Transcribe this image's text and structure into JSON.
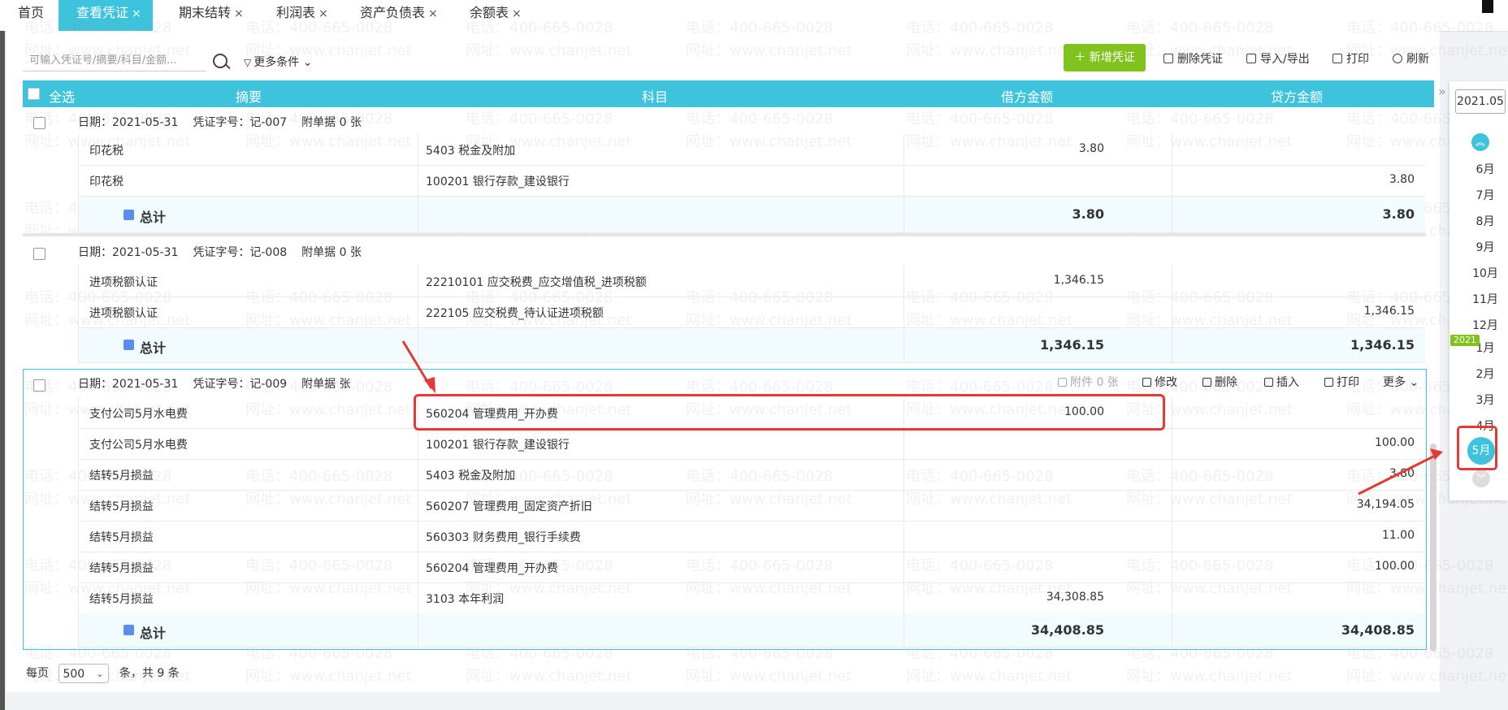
{
  "tabs": [
    {
      "label": "首页",
      "closable": false
    },
    {
      "label": "查看凭证",
      "closable": true,
      "active": true
    },
    {
      "label": "期末结转",
      "closable": true
    },
    {
      "label": "利润表",
      "closable": true
    },
    {
      "label": "资产负债表",
      "closable": true
    },
    {
      "label": "余额表",
      "closable": true
    }
  ],
  "tab_close_glyph": "×",
  "toolbar": {
    "search_placeholder": "可输入凭证号/摘要/科目/金额...",
    "more_conditions": "更多条件",
    "add": "新增凭证",
    "delete": "删除凭证",
    "import_export": "导入/导出",
    "print": "打印",
    "refresh": "刷新"
  },
  "table_header": {
    "select_all": "全选",
    "summary": "摘要",
    "subject": "科目",
    "debit": "借方金额",
    "credit": "贷方金额"
  },
  "vouchers": [
    {
      "date_label": "日期：2021-05-31",
      "no_label": "凭证字号：记-007",
      "attach_label": "附单据 0 张",
      "rows": [
        {
          "summary": "印花税",
          "subject": "5403 税金及附加",
          "debit": "3.80",
          "credit": ""
        },
        {
          "summary": "印花税",
          "subject": "100201 银行存款_建设银行",
          "debit": "",
          "credit": "3.80"
        }
      ],
      "total_label": "总计",
      "total_debit": "3.80",
      "total_credit": "3.80"
    },
    {
      "date_label": "日期：2021-05-31",
      "no_label": "凭证字号：记-008",
      "attach_label": "附单据 0 张",
      "rows": [
        {
          "summary": "进项税额认证",
          "subject": "22210101 应交税费_应交增值税_进项税额",
          "debit": "1,346.15",
          "credit": ""
        },
        {
          "summary": "进项税额认证",
          "subject": "222105 应交税费_待认证进项税额",
          "debit": "",
          "credit": "1,346.15"
        }
      ],
      "total_label": "总计",
      "total_debit": "1,346.15",
      "total_credit": "1,346.15"
    },
    {
      "date_label": "日期：2021-05-31",
      "no_label": "凭证字号：记-009",
      "attach_label": "附单据  张",
      "actions": {
        "attach": "附件 0 张",
        "edit": "修改",
        "delete": "删除",
        "insert": "插入",
        "print": "打印",
        "more": "更多"
      },
      "rows": [
        {
          "summary": "支付公司5月水电费",
          "subject": "560204 管理费用_开办费",
          "debit": "100.00",
          "credit": ""
        },
        {
          "summary": "支付公司5月水电费",
          "subject": "100201 银行存款_建设银行",
          "debit": "",
          "credit": "100.00"
        },
        {
          "summary": "结转5月损益",
          "subject": "5403 税金及附加",
          "debit": "",
          "credit": "3.80"
        },
        {
          "summary": "结转5月损益",
          "subject": "560207 管理费用_固定资产折旧",
          "debit": "",
          "credit": "34,194.05"
        },
        {
          "summary": "结转5月损益",
          "subject": "560303 财务费用_银行手续费",
          "debit": "",
          "credit": "11.00"
        },
        {
          "summary": "结转5月损益",
          "subject": "560204 管理费用_开办费",
          "debit": "",
          "credit": "100.00"
        },
        {
          "summary": "结转5月损益",
          "subject": "3103 本年利润",
          "debit": "34,308.85",
          "credit": ""
        }
      ],
      "total_label": "总计",
      "total_debit": "34,408.85",
      "total_credit": "34,408.85"
    }
  ],
  "pagination": {
    "per_page_label": "每页",
    "per_page_value": "500",
    "total_text": "条，共 9 条"
  },
  "month_panel": {
    "current": "2021.05",
    "months_before": [
      "6月",
      "7月",
      "8月",
      "9月",
      "10月",
      "11月",
      "12月"
    ],
    "year_badge": "2021",
    "months_after": [
      "1月",
      "2月",
      "3月",
      "4月"
    ],
    "selected": "5月"
  },
  "watermark": {
    "phone": "电话：400-665-0028",
    "site": "网址：www.chanjet.net"
  },
  "colors": {
    "accent": "#3ec3dc",
    "add_button": "#82c21e",
    "annotation": "#e53935"
  }
}
